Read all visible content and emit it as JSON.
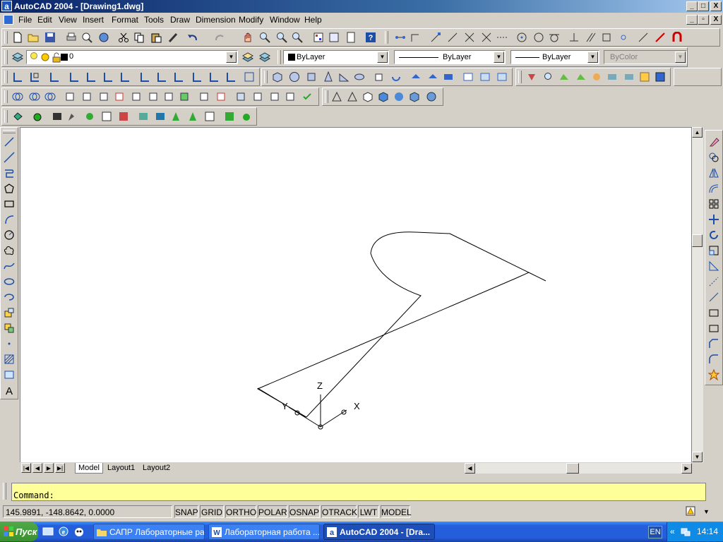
{
  "window": {
    "title": "AutoCAD 2004 - [Drawing1.dwg]",
    "app_icon_letter": "a",
    "controls": [
      "_",
      "□",
      "X"
    ],
    "doc_controls": [
      "_",
      "▫",
      "X"
    ]
  },
  "menu": [
    "File",
    "Edit",
    "View",
    "Insert",
    "Format",
    "Tools",
    "Draw",
    "Dimension",
    "Modify",
    "Window",
    "Help"
  ],
  "layers_toolbar": {
    "layer_name": "0",
    "color": "ByLayer",
    "linetype": "ByLayer",
    "lineweight": "ByLayer",
    "plotstyle": "ByColor"
  },
  "ucs": {
    "z_label": "Z",
    "y_label": "Y",
    "x_label": "X"
  },
  "layout_tabs": [
    "Model",
    "Layout1",
    "Layout2"
  ],
  "active_tab": "Model",
  "command": {
    "prompt": "Command:"
  },
  "status": {
    "coordinates": "145.9891, -148.8642, 0.0000",
    "toggles": [
      "SNAP",
      "GRID",
      "ORTHO",
      "POLAR",
      "OSNAP",
      "OTRACK",
      "LWT",
      "MODEL"
    ]
  },
  "taskbar": {
    "start_label": "Пуск",
    "tasks": [
      "САПР Лабораторные ра...",
      "Лабораторная работа ...",
      "AutoCAD 2004 - [Dra..."
    ],
    "language": "EN",
    "clock": "14:14"
  },
  "colors": {
    "title_gradient_start": "#0a246a",
    "command_background": "#ffff99",
    "taskbar_blue": "#245edb"
  }
}
